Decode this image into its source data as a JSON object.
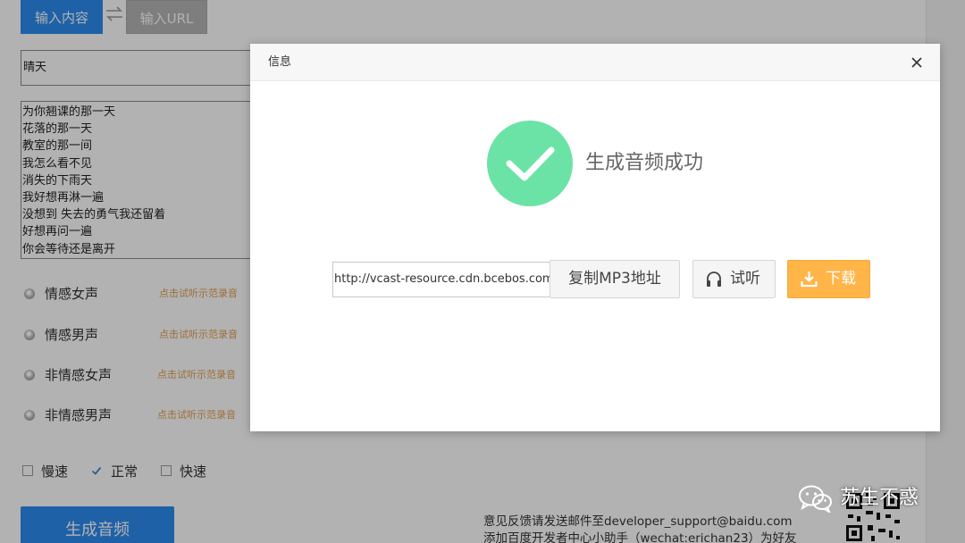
{
  "tabs": {
    "input_content": "输入内容",
    "input_url": "输入URL"
  },
  "title_input": {
    "value": "晴天"
  },
  "content_lines": [
    "为你翘课的那一天",
    "花落的那一天",
    "教室的那一间",
    "我怎么看不见",
    "消失的下雨天",
    "我好想再淋一遍",
    "没想到 失去的勇气我还留着",
    "好想再问一遍",
    "你会等待还是离开"
  ],
  "voices": [
    {
      "label": "情感女声",
      "demo": "点击试听示范录音",
      "selected": false
    },
    {
      "label": "情感男声",
      "demo": "点击试听示范录音",
      "selected": false
    },
    {
      "label": "非情感女声",
      "demo": "点击试听示范录音",
      "selected": false
    },
    {
      "label": "非情感男声",
      "demo": "点击试听示范录音",
      "selected": false
    }
  ],
  "speeds": [
    {
      "label": "慢速",
      "checked": false
    },
    {
      "label": "正常",
      "checked": true
    },
    {
      "label": "快速",
      "checked": false
    }
  ],
  "generate_button": "生成音频",
  "footer": {
    "line1": "意见反馈请发送邮件至developer_support@baidu.com",
    "line2": "添加百度开发者中心小助手（wechat:erichan23）为好友"
  },
  "watermark": {
    "name": "苏生不惑"
  },
  "modal": {
    "title": "信息",
    "success_message": "生成音频成功",
    "mp3_url": "http://vcast-resource.cdn.bcebos.com/vc",
    "copy_button": "复制MP3地址",
    "listen_button": "试听",
    "download_button": "下载"
  },
  "icons": {
    "swap": "swap-arrows-icon",
    "close": "close-icon",
    "success": "check-circle-icon",
    "listen": "headphones-icon",
    "download": "download-icon",
    "wechat": "wechat-logo-icon"
  },
  "colors": {
    "primary_blue": "#2d8cf0",
    "success_green": "#6ce3a6",
    "download_orange": "#ffb548",
    "demo_link_orange": "#e0a050",
    "overlay": "rgba(0,0,0,0.30)"
  }
}
